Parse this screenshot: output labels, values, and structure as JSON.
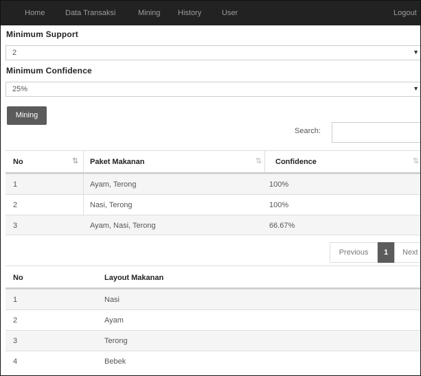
{
  "navbar": {
    "items": [
      "Home",
      "Data Transaksi",
      "Mining",
      "History",
      "User"
    ],
    "logout": "Logout"
  },
  "form": {
    "min_support_label": "Minimum Support",
    "min_support_value": "2",
    "min_confidence_label": "Minimum Confidence",
    "min_confidence_value": "25%",
    "mining_button": "Mining"
  },
  "search": {
    "label": "Search:",
    "value": ""
  },
  "rules_table": {
    "headers": [
      "No",
      "Paket Makanan",
      "Confidence"
    ],
    "rows": [
      [
        "1",
        "Ayam, Terong",
        "100%"
      ],
      [
        "2",
        "Nasi, Terong",
        "100%"
      ],
      [
        "3",
        "Ayam, Nasi, Terong",
        "66.67%"
      ]
    ]
  },
  "pagination": {
    "previous": "Previous",
    "current": "1",
    "next": "Next"
  },
  "layout_table": {
    "headers": [
      "No",
      "Layout Makanan"
    ],
    "rows": [
      [
        "1",
        "Nasi"
      ],
      [
        "2",
        "Ayam"
      ],
      [
        "3",
        "Terong"
      ],
      [
        "4",
        "Bebek"
      ]
    ]
  }
}
